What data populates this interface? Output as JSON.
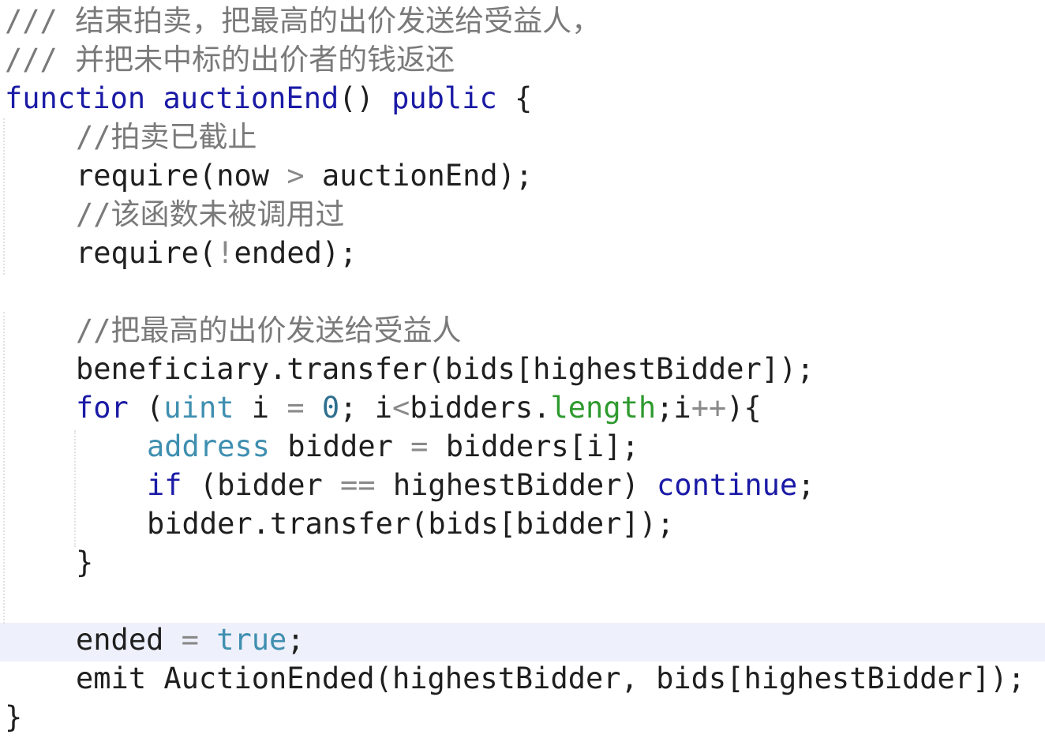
{
  "editor": {
    "colors": {
      "default": "#1f1f1f",
      "keyword": "#1a1aa6",
      "type": "#3f8fb0",
      "member": "#2e9a2e",
      "number": "#2f6f8f",
      "comment": "#7a7a7a",
      "operator": "#8a8a8a",
      "line_highlight": "#eef0fb"
    },
    "lines": [
      {
        "indent": 0,
        "tokens": [
          {
            "text": "/// 结束拍卖，把最高的出价发送给受益人，",
            "type": "comment"
          }
        ]
      },
      {
        "indent": 0,
        "tokens": [
          {
            "text": "/// 并把未中标的出价者的钱返还",
            "type": "comment"
          }
        ]
      },
      {
        "indent": 0,
        "tokens": [
          {
            "text": "function",
            "type": "keyword"
          },
          {
            "text": " auctionEnd",
            "type": "keyword"
          },
          {
            "text": "() ",
            "type": "default"
          },
          {
            "text": "public",
            "type": "keyword"
          },
          {
            "text": " {",
            "type": "default"
          }
        ]
      },
      {
        "indent": 1,
        "tokens": [
          {
            "text": "//拍卖已截止",
            "type": "comment"
          }
        ]
      },
      {
        "indent": 1,
        "tokens": [
          {
            "text": "require(now ",
            "type": "default"
          },
          {
            "text": ">",
            "type": "operator"
          },
          {
            "text": " auctionEnd);",
            "type": "default"
          }
        ]
      },
      {
        "indent": 1,
        "tokens": [
          {
            "text": "//该函数未被调用过",
            "type": "comment"
          }
        ]
      },
      {
        "indent": 1,
        "tokens": [
          {
            "text": "require(",
            "type": "default"
          },
          {
            "text": "!",
            "type": "operator"
          },
          {
            "text": "ended);",
            "type": "default"
          }
        ]
      },
      {
        "indent": 0,
        "tokens": []
      },
      {
        "indent": 1,
        "tokens": [
          {
            "text": "//把最高的出价发送给受益人",
            "type": "comment"
          }
        ]
      },
      {
        "indent": 1,
        "tokens": [
          {
            "text": "beneficiary.transfer(bids[highestBidder]);",
            "type": "default"
          }
        ]
      },
      {
        "indent": 1,
        "tokens": [
          {
            "text": "for",
            "type": "keyword"
          },
          {
            "text": " (",
            "type": "default"
          },
          {
            "text": "uint",
            "type": "type"
          },
          {
            "text": " i ",
            "type": "default"
          },
          {
            "text": "=",
            "type": "operator"
          },
          {
            "text": " ",
            "type": "default"
          },
          {
            "text": "0",
            "type": "number"
          },
          {
            "text": "; i",
            "type": "default"
          },
          {
            "text": "<",
            "type": "operator"
          },
          {
            "text": "bidders.",
            "type": "default"
          },
          {
            "text": "length",
            "type": "member"
          },
          {
            "text": ";i",
            "type": "default"
          },
          {
            "text": "++",
            "type": "operator"
          },
          {
            "text": "){",
            "type": "default"
          }
        ]
      },
      {
        "indent": 2,
        "tokens": [
          {
            "text": "address",
            "type": "type"
          },
          {
            "text": " bidder ",
            "type": "default"
          },
          {
            "text": "=",
            "type": "operator"
          },
          {
            "text": " bidders[i];",
            "type": "default"
          }
        ]
      },
      {
        "indent": 2,
        "tokens": [
          {
            "text": "if",
            "type": "keyword"
          },
          {
            "text": " (bidder ",
            "type": "default"
          },
          {
            "text": "==",
            "type": "operator"
          },
          {
            "text": " highestBidder) ",
            "type": "default"
          },
          {
            "text": "continue",
            "type": "keyword"
          },
          {
            "text": ";",
            "type": "default"
          }
        ]
      },
      {
        "indent": 2,
        "tokens": [
          {
            "text": "bidder.transfer(bids[bidder]);",
            "type": "default"
          }
        ]
      },
      {
        "indent": 1,
        "tokens": [
          {
            "text": "}",
            "type": "default"
          }
        ]
      },
      {
        "indent": 0,
        "tokens": []
      },
      {
        "indent": 1,
        "tokens": [
          {
            "text": "ended ",
            "type": "default"
          },
          {
            "text": "=",
            "type": "operator"
          },
          {
            "text": " ",
            "type": "default"
          },
          {
            "text": "true",
            "type": "type"
          },
          {
            "text": ";",
            "type": "default"
          }
        ]
      },
      {
        "indent": 1,
        "tokens": [
          {
            "text": "emit AuctionEnded(highestBidder, bids[highestBidder]);",
            "type": "default"
          }
        ]
      },
      {
        "indent": 0,
        "tokens": [
          {
            "text": "}",
            "type": "default"
          }
        ]
      }
    ]
  }
}
